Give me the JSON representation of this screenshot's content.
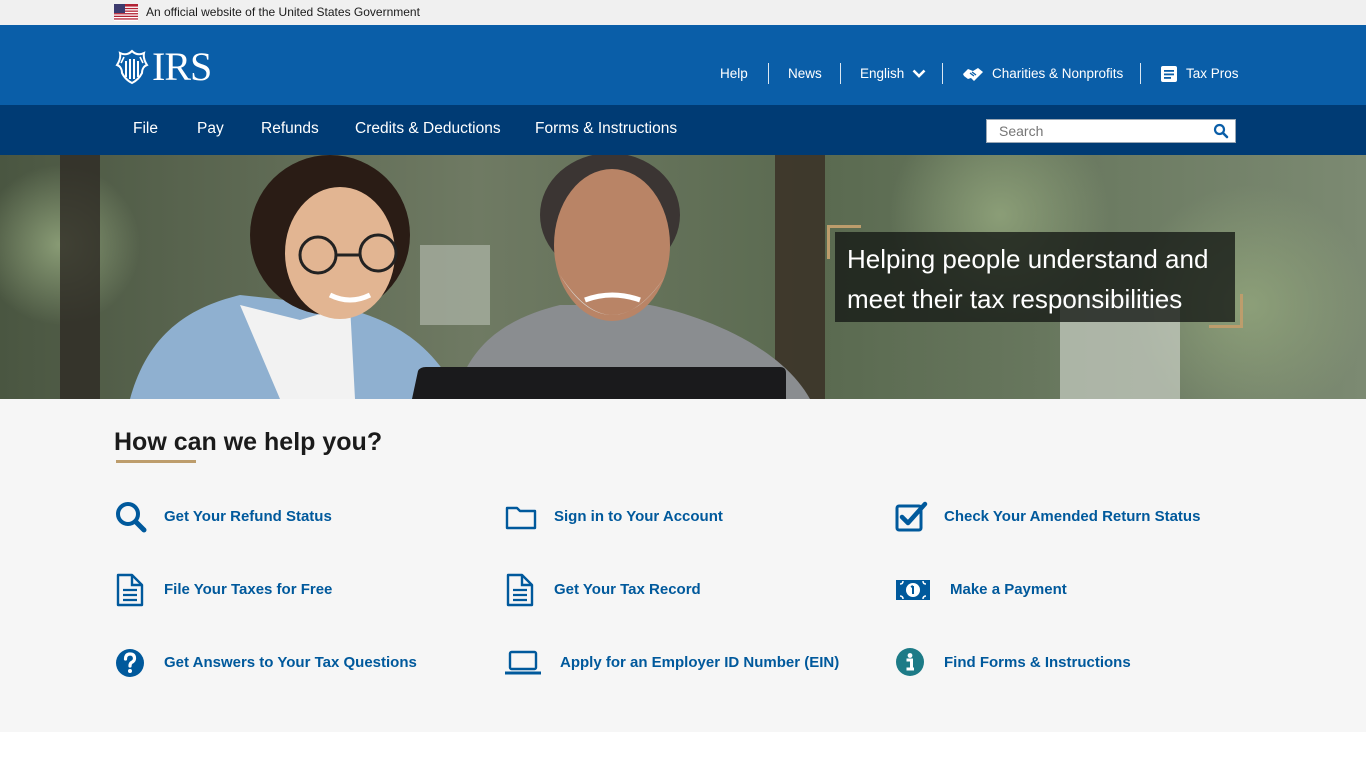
{
  "gov_banner": {
    "text": "An official website of the United States Government"
  },
  "header": {
    "logo_text": "IRS",
    "utility_nav": [
      {
        "label": "Help"
      },
      {
        "label": "News"
      },
      {
        "label": "English"
      },
      {
        "label": "Charities & Nonprofits",
        "icon": "handshake-icon"
      },
      {
        "label": "Tax Pros",
        "icon": "clipboard-icon"
      }
    ]
  },
  "main_nav": {
    "items": [
      {
        "label": "File"
      },
      {
        "label": "Pay"
      },
      {
        "label": "Refunds"
      },
      {
        "label": "Credits & Deductions"
      },
      {
        "label": "Forms & Instructions"
      }
    ],
    "search": {
      "placeholder": "Search",
      "icon": "search-icon"
    }
  },
  "hero": {
    "tagline": "Helping people understand and meet their tax responsibilities"
  },
  "help": {
    "title": "How can we help you?",
    "tiles": [
      {
        "label": "Get Your Refund Status",
        "icon": "magnifier-icon"
      },
      {
        "label": "Sign in to Your Account",
        "icon": "folder-icon"
      },
      {
        "label": "Check Your Amended Return Status",
        "icon": "checkbox-icon"
      },
      {
        "label": "File Your Taxes for Free",
        "icon": "document-icon"
      },
      {
        "label": "Get Your Tax Record",
        "icon": "document-icon"
      },
      {
        "label": "Make a Payment",
        "icon": "money-icon"
      },
      {
        "label": "Get Answers to Your Tax Questions",
        "icon": "question-icon"
      },
      {
        "label": "Apply for an Employer ID Number (EIN)",
        "icon": "laptop-icon"
      },
      {
        "label": "Find Forms & Instructions",
        "icon": "info-icon"
      }
    ]
  },
  "colors": {
    "header_blue": "#0a5ea8",
    "nav_navy": "#003b74",
    "link_blue": "#00599c",
    "accent_gold": "#bd9d6c",
    "info_teal": "#1d7b87"
  }
}
